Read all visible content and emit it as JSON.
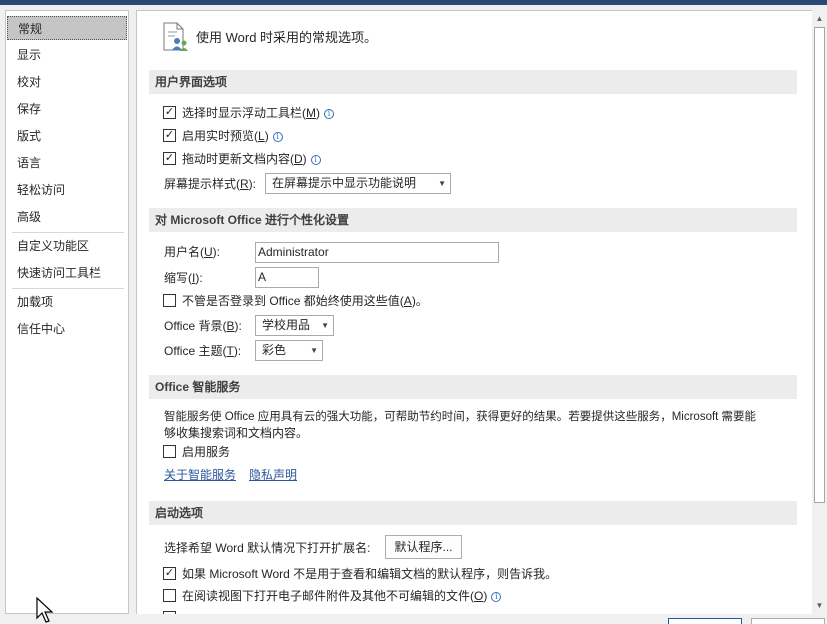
{
  "nav": {
    "items": [
      {
        "label": "常规"
      },
      {
        "label": "显示"
      },
      {
        "label": "校对"
      },
      {
        "label": "保存"
      },
      {
        "label": "版式"
      },
      {
        "label": "语言"
      },
      {
        "label": "轻松访问"
      },
      {
        "label": "高级"
      },
      {
        "label": "自定义功能区"
      },
      {
        "label": "快速访问工具栏"
      },
      {
        "label": "加载项"
      },
      {
        "label": "信任中心"
      }
    ],
    "selected": "常规"
  },
  "header": {
    "text": "使用 Word 时采用的常规选项。",
    "icon": "general-options-icon"
  },
  "ui_options": {
    "title": "用户界面选项",
    "mini_toolbar": {
      "pre": "选择时显示浮动工具栏(",
      "key": "M",
      "post": ")",
      "checked": true
    },
    "live_preview": {
      "pre": "启用实时预览(",
      "key": "L",
      "post": ")",
      "checked": true
    },
    "update_drag": {
      "pre": "拖动时更新文档内容(",
      "key": "D",
      "post": ")",
      "checked": true
    },
    "screentip": {
      "pre": "屏幕提示样式(",
      "key": "R",
      "post": "):",
      "value": "在屏幕提示中显示功能说明"
    }
  },
  "personalize": {
    "title": "对 Microsoft Office 进行个性化设置",
    "username": {
      "pre": "用户名(",
      "key": "U",
      "post": "):",
      "value": "Administrator"
    },
    "initials": {
      "pre": "缩写(",
      "key": "I",
      "post": "):",
      "value": "A"
    },
    "always_use": {
      "pre": "不管是否登录到 Office 都始终使用这些值(",
      "key": "A",
      "post": ")。",
      "checked": false
    },
    "background": {
      "pre": "Office 背景(",
      "key": "B",
      "post": "):",
      "value": "学校用品"
    },
    "theme": {
      "pre": "Office 主题(",
      "key": "T",
      "post": "):",
      "value": "彩色"
    }
  },
  "intelligent": {
    "title": "Office 智能服务",
    "desc1": "智能服务使 Office 应用具有云的强大功能，可帮助节约时间，获得更好的结果。若要提供这些服务，Microsoft 需要能",
    "desc2": "够收集搜索词和文档内容。",
    "enable": {
      "label": "启用服务",
      "checked": false
    },
    "about_link": "关于智能服务",
    "privacy_link": "隐私声明"
  },
  "startup": {
    "title": "启动选项",
    "ext_label": "选择希望 Word 默认情况下打开扩展名:",
    "default_programs": "默认程序...",
    "tell_me": {
      "label": "如果 Microsoft Word 不是用于查看和编辑文档的默认程序，则告诉我。",
      "checked": true
    },
    "reading_view": {
      "pre": "在阅读视图下打开电子邮件附件及其他不可编辑的文件(",
      "key": "O",
      "post": ")",
      "checked": false
    }
  },
  "colors": {
    "section_bg": "#ececec",
    "link": "#2b579a",
    "selected_nav": "#c5c5c5",
    "title_bar": "#2b4a73"
  }
}
